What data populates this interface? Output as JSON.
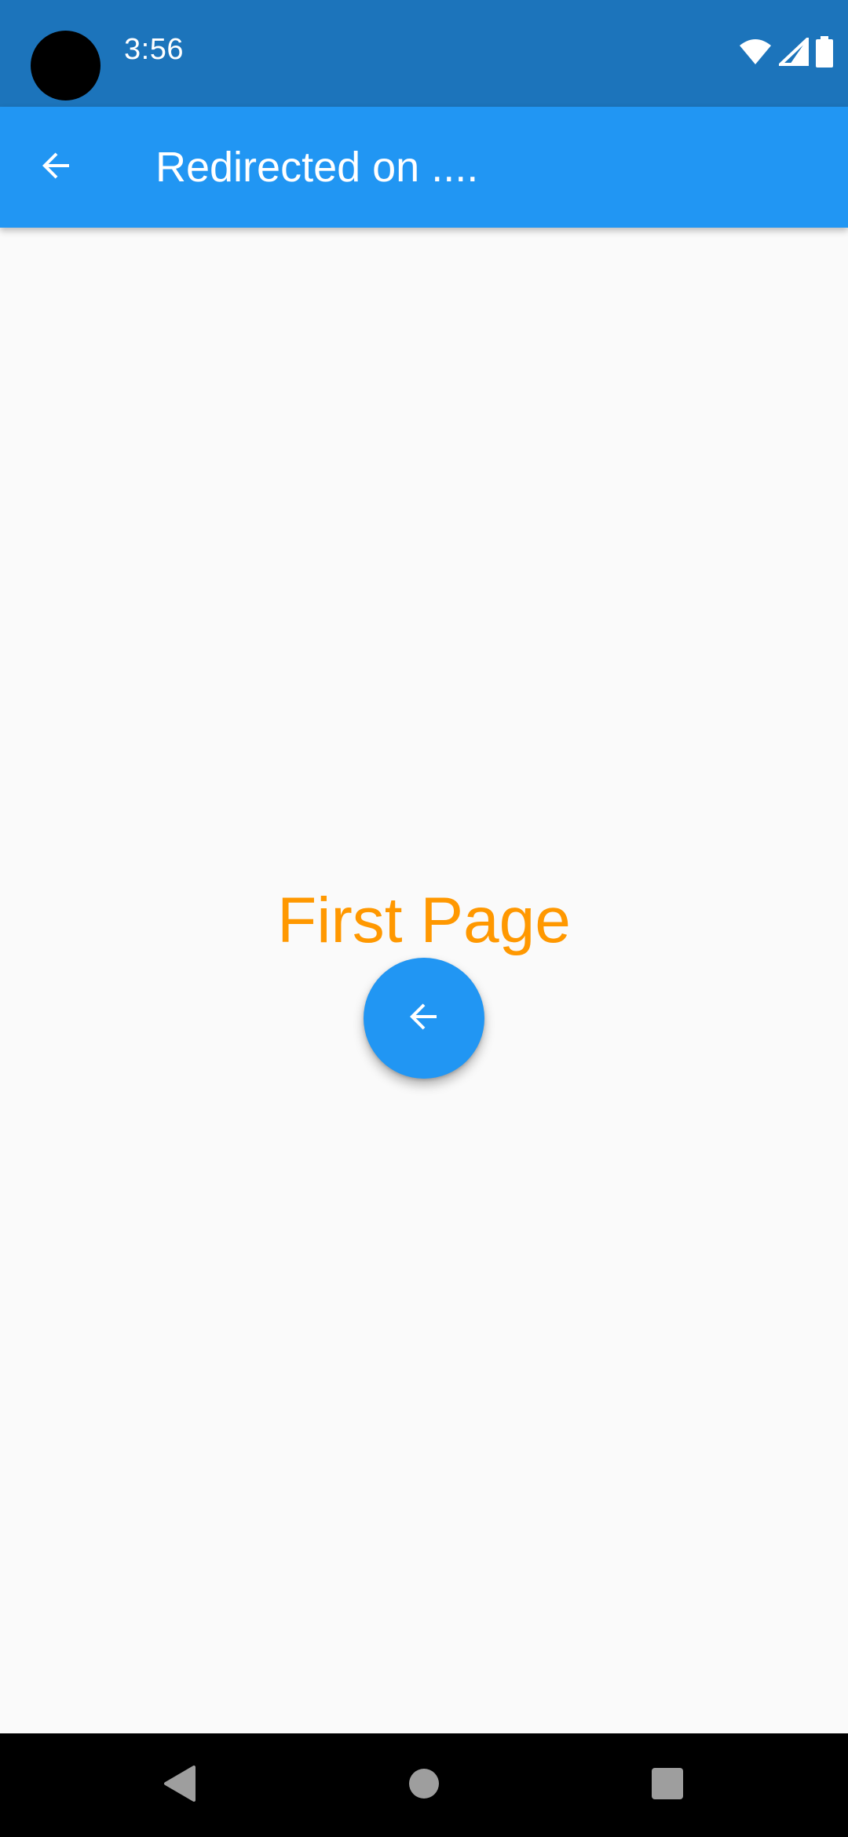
{
  "status_bar": {
    "time": "3:56",
    "icons": [
      "wifi-icon",
      "signal-icon",
      "battery-icon"
    ]
  },
  "app_bar": {
    "back_icon": "arrow-back-icon",
    "title": "Redirected on ...."
  },
  "body": {
    "page_label": "First Page",
    "fab_icon": "arrow-back-icon"
  },
  "nav_bar": {
    "buttons": [
      "nav-back-icon",
      "nav-home-icon",
      "nav-recents-icon"
    ]
  },
  "colors": {
    "status_bar": "#1C74BB",
    "app_bar": "#2196F3",
    "accent_text": "#FF9800",
    "background": "#FAFAFA",
    "nav_bar": "#000000"
  }
}
